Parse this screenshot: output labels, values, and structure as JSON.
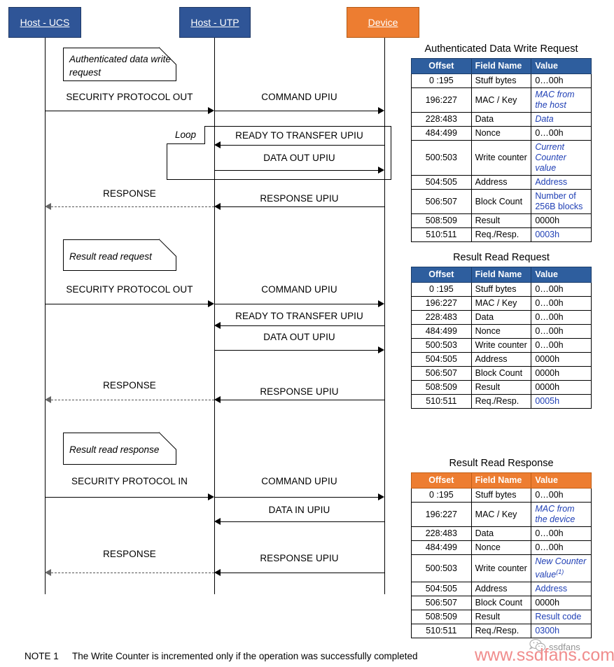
{
  "diagram": {
    "actors": [
      {
        "id": "host-ucs",
        "label": "Host - UCS",
        "color": "#2f5597"
      },
      {
        "id": "host-utp",
        "label": "Host - UTP",
        "color": "#2f5597"
      },
      {
        "id": "device",
        "label": "Device",
        "color": "#ed7d31"
      }
    ],
    "notes": [
      {
        "id": "note-auth-write",
        "text": "Authenticated data write request"
      },
      {
        "id": "note-result-read-request",
        "text": "Result read request"
      },
      {
        "id": "note-result-read-response",
        "text": "Result read response"
      }
    ],
    "loop_label": "Loop",
    "messages": [
      {
        "id": "m1",
        "label": "SECURITY PROTOCOL OUT"
      },
      {
        "id": "m2",
        "label": "COMMAND UPIU"
      },
      {
        "id": "m3",
        "label": "READY TO TRANSFER UPIU"
      },
      {
        "id": "m4",
        "label": "DATA OUT UPIU"
      },
      {
        "id": "m5",
        "label": "RESPONSE"
      },
      {
        "id": "m6",
        "label": "RESPONSE UPIU"
      },
      {
        "id": "m7",
        "label": "SECURITY PROTOCOL OUT"
      },
      {
        "id": "m8",
        "label": "COMMAND UPIU"
      },
      {
        "id": "m9",
        "label": "READY TO TRANSFER UPIU"
      },
      {
        "id": "m10",
        "label": "DATA OUT UPIU"
      },
      {
        "id": "m11",
        "label": "RESPONSE"
      },
      {
        "id": "m12",
        "label": "RESPONSE UPIU"
      },
      {
        "id": "m13",
        "label": "SECURITY PROTOCOL IN"
      },
      {
        "id": "m14",
        "label": "COMMAND UPIU"
      },
      {
        "id": "m15",
        "label": "DATA IN UPIU"
      },
      {
        "id": "m16",
        "label": "RESPONSE"
      },
      {
        "id": "m17",
        "label": "RESPONSE UPIU"
      }
    ]
  },
  "tables": [
    {
      "id": "authenticated-data-write-request",
      "title": "Authenticated Data Write Request",
      "header_color": "#2e5e9e",
      "columns": [
        "Offset",
        "Field Name",
        "Value"
      ],
      "rows": [
        {
          "offset": "0 :195",
          "field": "Stuff bytes",
          "value": "0…00h",
          "style": "plain"
        },
        {
          "offset": "196:227",
          "field": "MAC / Key",
          "value": "MAC from the host",
          "style": "blue-italic"
        },
        {
          "offset": "228:483",
          "field": "Data",
          "value": "Data",
          "style": "blue-italic"
        },
        {
          "offset": "484:499",
          "field": "Nonce",
          "value": "0…00h",
          "style": "plain"
        },
        {
          "offset": "500:503",
          "field": "Write counter",
          "value": "Current Counter value",
          "style": "blue-italic"
        },
        {
          "offset": "504:505",
          "field": "Address",
          "value": "Address",
          "style": "blue"
        },
        {
          "offset": "506:507",
          "field": "Block Count",
          "value": "Number of 256B blocks",
          "style": "blue"
        },
        {
          "offset": "508:509",
          "field": "Result",
          "value": "0000h",
          "style": "plain"
        },
        {
          "offset": "510:511",
          "field": "Req./Resp.",
          "value": "0003h",
          "style": "blue"
        }
      ]
    },
    {
      "id": "result-read-request",
      "title": "Result Read Request",
      "header_color": "#2e5e9e",
      "columns": [
        "Offset",
        "Field Name",
        "Value"
      ],
      "rows": [
        {
          "offset": "0 :195",
          "field": "Stuff bytes",
          "value": "0…00h",
          "style": "plain"
        },
        {
          "offset": "196:227",
          "field": "MAC / Key",
          "value": "0…00h",
          "style": "plain"
        },
        {
          "offset": "228:483",
          "field": "Data",
          "value": "0…00h",
          "style": "plain"
        },
        {
          "offset": "484:499",
          "field": "Nonce",
          "value": "0…00h",
          "style": "plain"
        },
        {
          "offset": "500:503",
          "field": "Write counter",
          "value": "0…00h",
          "style": "plain"
        },
        {
          "offset": "504:505",
          "field": "Address",
          "value": "0000h",
          "style": "plain"
        },
        {
          "offset": "506:507",
          "field": "Block Count",
          "value": "0000h",
          "style": "plain"
        },
        {
          "offset": "508:509",
          "field": "Result",
          "value": "0000h",
          "style": "plain"
        },
        {
          "offset": "510:511",
          "field": "Req./Resp.",
          "value": "0005h",
          "style": "blue"
        }
      ]
    },
    {
      "id": "result-read-response",
      "title": "Result Read Response",
      "header_color": "#ed7d31",
      "columns": [
        "Offset",
        "Field Name",
        "Value"
      ],
      "rows": [
        {
          "offset": "0 :195",
          "field": "Stuff bytes",
          "value": "0…00h",
          "style": "plain"
        },
        {
          "offset": "196:227",
          "field": "MAC / Key",
          "value": "MAC from the device",
          "style": "blue-italic"
        },
        {
          "offset": "228:483",
          "field": "Data",
          "value": "0…00h",
          "style": "plain"
        },
        {
          "offset": "484:499",
          "field": "Nonce",
          "value": "0…00h",
          "style": "plain"
        },
        {
          "offset": "500:503",
          "field": "Write counter",
          "value": "New Counter value",
          "value_sup": "(1)",
          "style": "blue-italic"
        },
        {
          "offset": "504:505",
          "field": "Address",
          "value": "Address",
          "style": "blue"
        },
        {
          "offset": "506:507",
          "field": "Block Count",
          "value": "0000h",
          "style": "plain"
        },
        {
          "offset": "508:509",
          "field": "Result",
          "value": "Result code",
          "style": "blue"
        },
        {
          "offset": "510:511",
          "field": "Req./Resp.",
          "value": "0300h",
          "style": "blue"
        }
      ]
    }
  ],
  "footer": {
    "note_label": "NOTE 1",
    "note_text": "The Write Counter is incremented only if the operation was successfully completed"
  },
  "watermark": {
    "url": "www.ssdfans.com",
    "tag": "ssdfans"
  }
}
